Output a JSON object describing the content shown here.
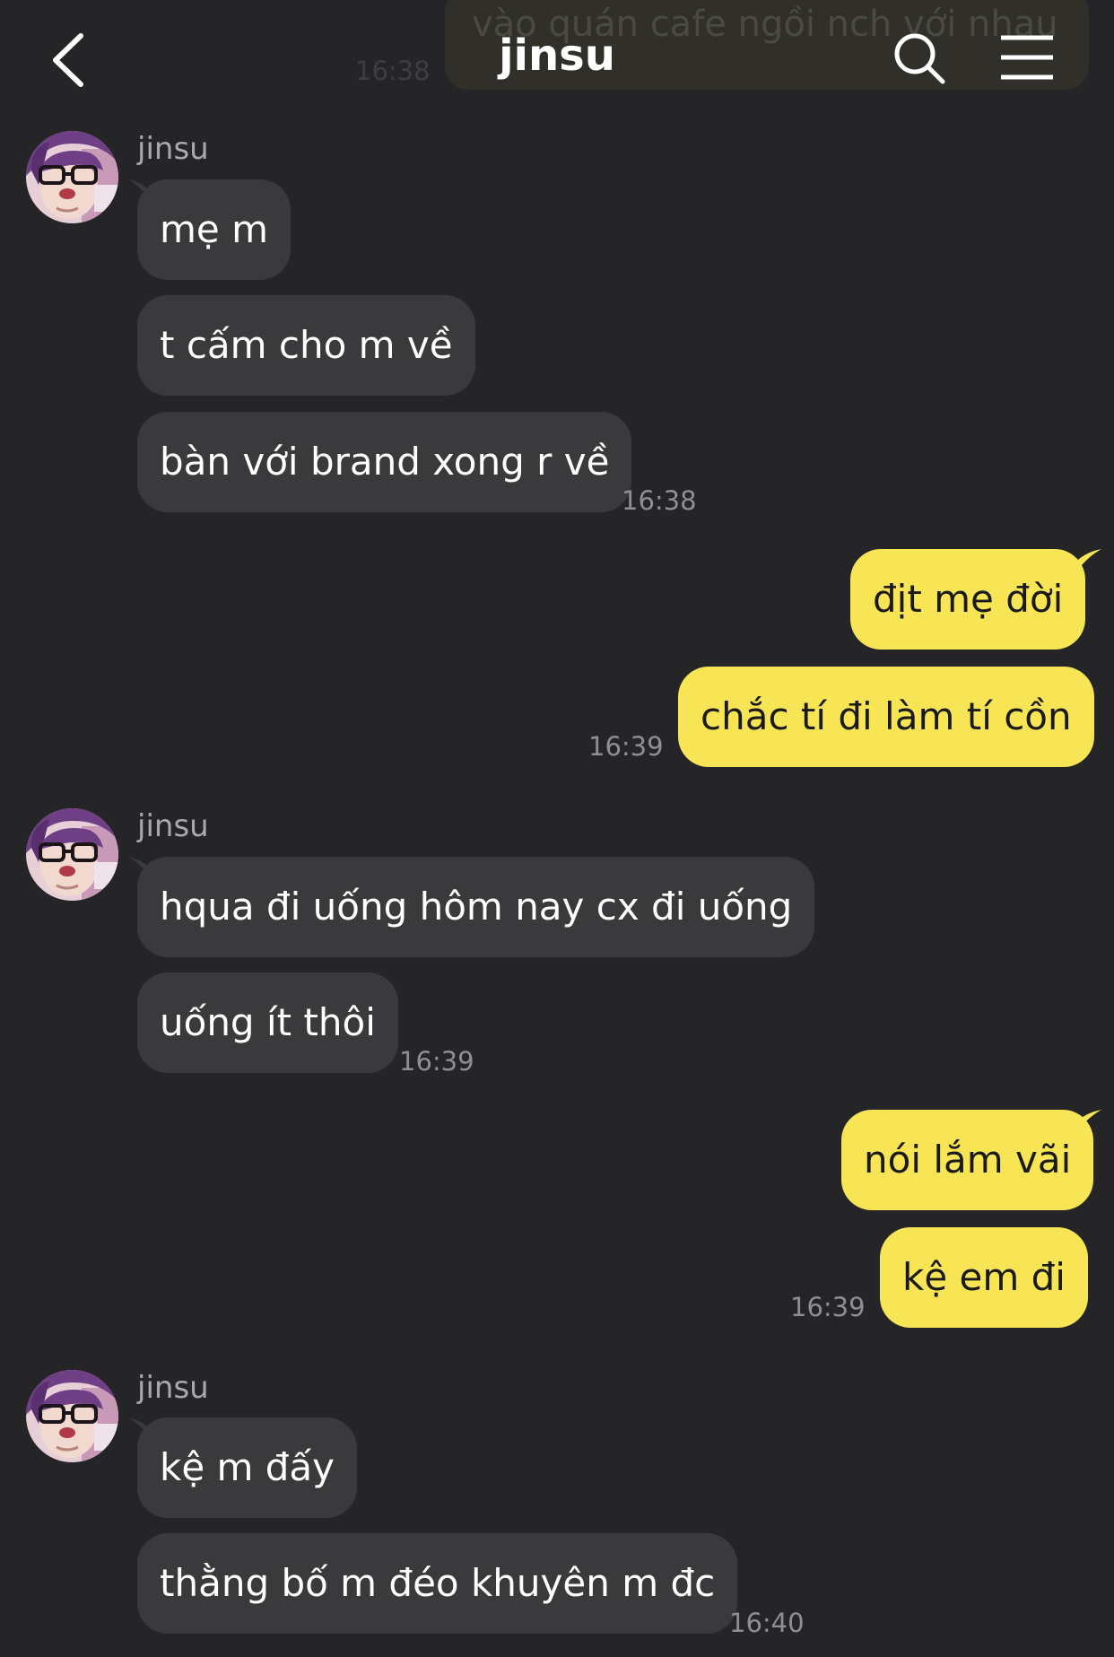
{
  "header": {
    "title": "jinsu",
    "ghost_message": "vào quán cafe ngồi nch với nhau",
    "ghost_time": "16:38"
  },
  "colors": {
    "background": "#252528",
    "incoming_bubble": "#3a3a3d",
    "outgoing_bubble": "#f8e555"
  },
  "icons": {
    "back": "chevron-left-icon",
    "search": "search-icon",
    "menu": "hamburger-menu-icon"
  },
  "groups": [
    {
      "sender": "jinsu",
      "direction": "incoming",
      "messages": [
        "mẹ m",
        "t cấm cho m về",
        "bàn với brand xong r về"
      ],
      "time": "16:38"
    },
    {
      "direction": "outgoing",
      "messages": [
        "địt mẹ đời",
        "chắc tí đi làm tí cồn"
      ],
      "time": "16:39"
    },
    {
      "sender": "jinsu",
      "direction": "incoming",
      "messages": [
        "hqua đi uống hôm nay cx đi uống",
        "uống ít thôi"
      ],
      "time": "16:39"
    },
    {
      "direction": "outgoing",
      "messages": [
        "nói lắm vãi",
        "kệ em đi"
      ],
      "time": "16:39"
    },
    {
      "sender": "jinsu",
      "direction": "incoming",
      "messages": [
        "kệ m đấy",
        "thằng bố m đéo khuyên m đc"
      ],
      "time": "16:40"
    }
  ]
}
